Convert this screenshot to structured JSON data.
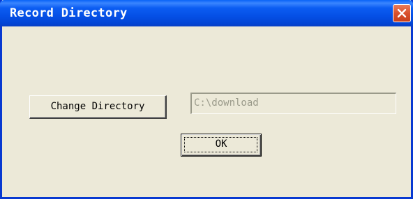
{
  "window": {
    "title": "Record Directory",
    "close_icon": "close-icon",
    "colors": {
      "titlebar": "#0550e6",
      "frame": "#0839d1",
      "close_button": "#d9512d",
      "face": "#ece9d8"
    }
  },
  "content": {
    "change_directory_label": "Change Directory",
    "directory_value": "C:\\download",
    "ok_label": "OK"
  }
}
